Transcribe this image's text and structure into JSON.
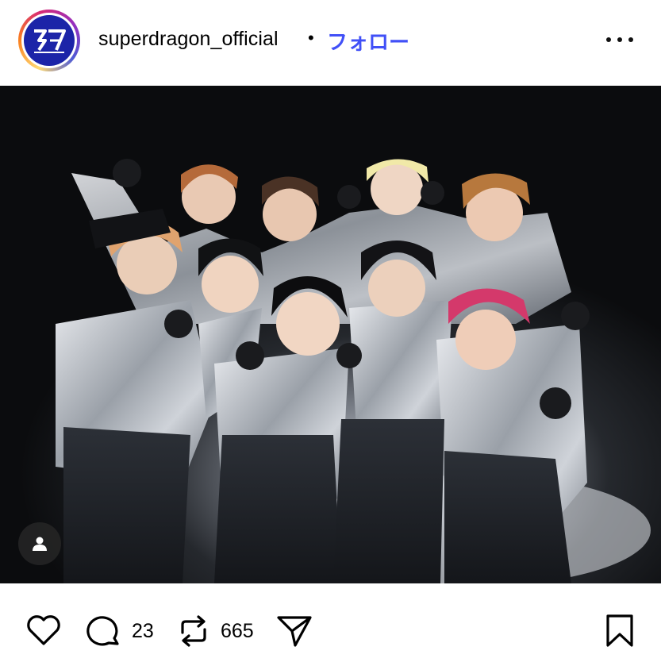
{
  "post": {
    "username": "superdragon_official",
    "separator": "•",
    "follow_label": "フォロー",
    "avatar_icon": "superdragon-logo",
    "more_icon": "more-horizontal-icon"
  },
  "photo": {
    "description_icon": "group-photo",
    "tag_icon": "user-tag-icon"
  },
  "actions": {
    "like_icon": "heart-icon",
    "comment_icon": "comment-icon",
    "comment_count": "23",
    "repost_icon": "repost-icon",
    "repost_count": "665",
    "share_icon": "send-icon",
    "save_icon": "bookmark-icon"
  },
  "colors": {
    "follow": "#4150f7",
    "avatar_bg": "#1c24a8"
  }
}
